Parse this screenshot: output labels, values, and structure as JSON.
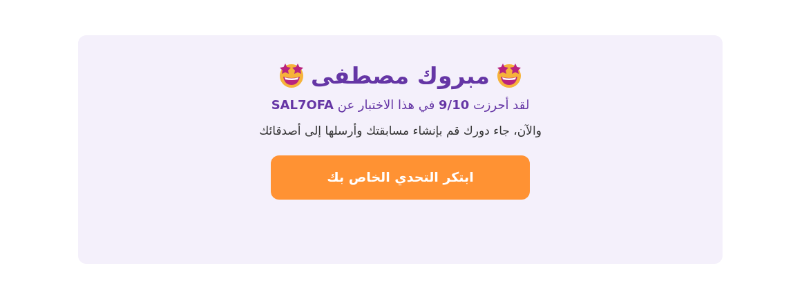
{
  "title": "مبروك مصطفى",
  "score_line": "لقد أحرزت **9/10** في هذا الاختبار عن **SAL7OFA**",
  "message": "والآن، جاء دورك قم بإنشاء مسابقتك وأرسلها إلى أصدقائك",
  "button": "ابتكر التحدي الخاص بك"
}
